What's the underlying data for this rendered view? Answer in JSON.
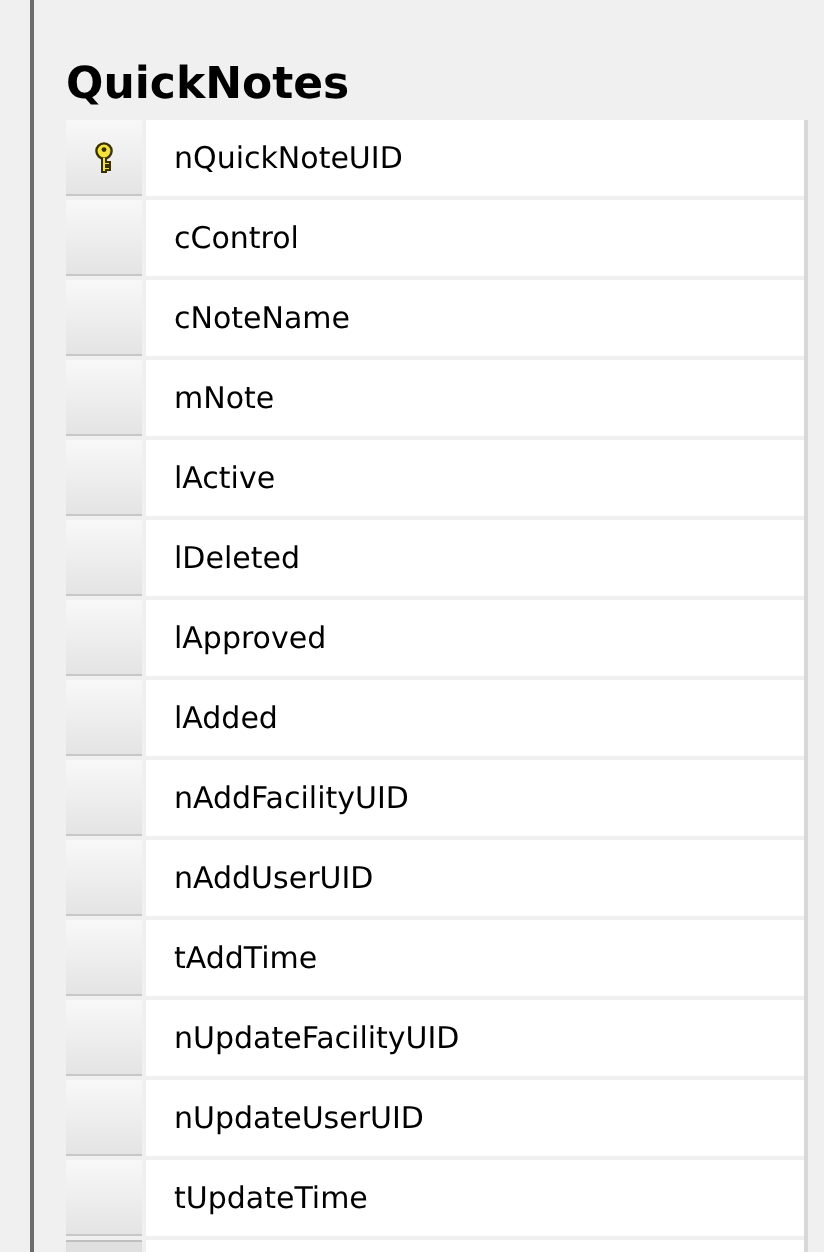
{
  "table": {
    "title": "QuickNotes",
    "columns": [
      {
        "name": "nQuickNoteUID",
        "primary_key": true
      },
      {
        "name": "cControl",
        "primary_key": false
      },
      {
        "name": "cNoteName",
        "primary_key": false
      },
      {
        "name": "mNote",
        "primary_key": false
      },
      {
        "name": "lActive",
        "primary_key": false
      },
      {
        "name": "lDeleted",
        "primary_key": false
      },
      {
        "name": "lApproved",
        "primary_key": false
      },
      {
        "name": "lAdded",
        "primary_key": false
      },
      {
        "name": "nAddFacilityUID",
        "primary_key": false
      },
      {
        "name": "nAddUserUID",
        "primary_key": false
      },
      {
        "name": "tAddTime",
        "primary_key": false
      },
      {
        "name": "nUpdateFacilityUID",
        "primary_key": false
      },
      {
        "name": "nUpdateUserUID",
        "primary_key": false
      },
      {
        "name": "tUpdateTime",
        "primary_key": false
      }
    ]
  }
}
